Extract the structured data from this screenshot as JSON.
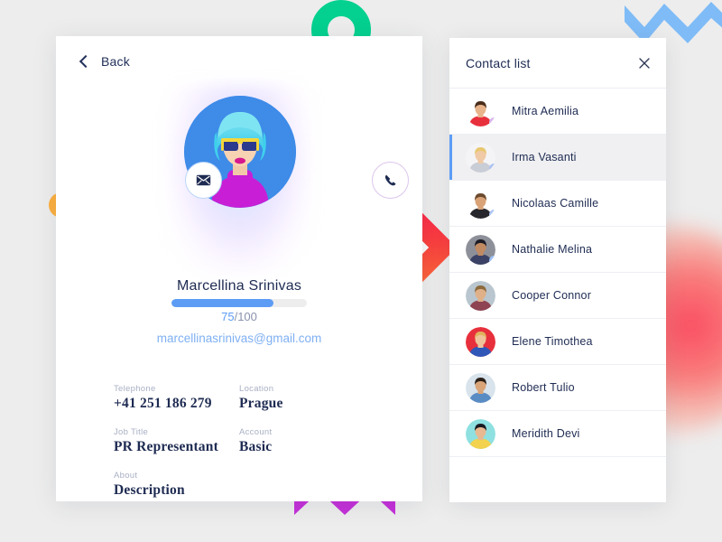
{
  "profile": {
    "back_label": "Back",
    "back_icon": "chevron-left-icon",
    "mail_icon": "envelope-icon",
    "phone_icon": "phone-icon",
    "name": "Marcellina Srinivas",
    "progress_percent": 75,
    "score_value": "75",
    "score_separator": "/",
    "score_total": "100",
    "email": "marcellinasrinivas@gmail.com",
    "avatar_alt": "profile-photo-woman-blue-hair",
    "fields": [
      {
        "label": "Telephone",
        "value": "+41  251 186 279"
      },
      {
        "label": "Location",
        "value": "Prague"
      },
      {
        "label": "Job Title",
        "value": "PR Representant"
      },
      {
        "label": "Account",
        "value": "Basic"
      },
      {
        "label": "About",
        "value": "Description"
      }
    ]
  },
  "contact_panel": {
    "title": "Contact list",
    "close_icon": "close-icon",
    "contacts": [
      {
        "name": "Mitra Aemilia",
        "selected": false,
        "skin": "#E8B48C",
        "hair": "#4A2C1A",
        "cloth": "#E8303C",
        "bg": "#FFFFFF",
        "badge": "#D9B6EC"
      },
      {
        "name": "Irma Vasanti",
        "selected": true,
        "skin": "#F0C9A6",
        "hair": "#E8C870",
        "cloth": "#C9CDD6",
        "bg": "#F4F4F6",
        "badge": "#AEC2F2"
      },
      {
        "name": "Nicolaas Camille",
        "selected": false,
        "skin": "#D9A377",
        "hair": "#6B4A2E",
        "cloth": "#26262C",
        "bg": "#FFFFFF",
        "badge": "#AEC6F5"
      },
      {
        "name": "Nathalie Melina",
        "selected": false,
        "skin": "#C08A63",
        "hair": "#1C1C26",
        "cloth": "#3B4266",
        "bg": "#8E9099",
        "badge": "#9CC0F7"
      },
      {
        "name": "Cooper Connor",
        "selected": false,
        "skin": "#E0B089",
        "hair": "#8C6A3E",
        "cloth": "#8E4452",
        "bg": "#B9C6CF",
        "badge": ""
      },
      {
        "name": "Elene Timothea",
        "selected": false,
        "skin": "#F0C49B",
        "hair": "#E0B35E",
        "cloth": "#2F57B8",
        "bg": "#E8303C",
        "badge": ""
      },
      {
        "name": "Robert Tulio",
        "selected": false,
        "skin": "#D9A478",
        "hair": "#2A2018",
        "cloth": "#5A8CC4",
        "bg": "#D8E3EC",
        "badge": ""
      },
      {
        "name": "Meridith Devi",
        "selected": false,
        "skin": "#E8B890",
        "hair": "#1A1A22",
        "cloth": "#F2D24E",
        "bg": "#8FE0E0",
        "badge": ""
      }
    ]
  },
  "decorations": {
    "green_ring": "#04D18F",
    "orange_dot": "#FCB040",
    "red_diamond_from": "#FB1D52",
    "red_diamond_to": "#FC7A36",
    "blue_zigzag": "#7FBCF7",
    "magenta_zigzag": "#C431D9",
    "pink_blur": "#FB3F55",
    "background": "#ededed"
  }
}
